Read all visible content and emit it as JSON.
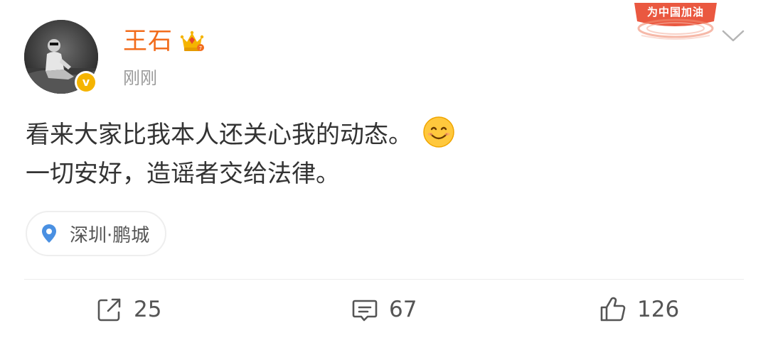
{
  "post": {
    "author": {
      "name": "王石",
      "verified_icon": "verified-badge-icon",
      "crown_badge_icon": "crown-icon"
    },
    "timestamp": "刚刚",
    "event_badge": "为中国加油",
    "content": {
      "line1": "看来大家比我本人还关心我的动态。",
      "line2": "一切安好，造谣者交给法律。"
    },
    "location": "深圳·鹏城"
  },
  "actions": {
    "repost": {
      "icon": "share-icon",
      "count": "25"
    },
    "comment": {
      "icon": "comment-icon",
      "count": "67"
    },
    "like": {
      "icon": "thumbs-up-icon",
      "count": "126"
    }
  },
  "colors": {
    "username": "#f26c1c",
    "text": "#333333",
    "muted": "#9a9a9a",
    "verified": "#f5b400",
    "location_pin": "#4a90e2",
    "badge": "#e8462b"
  }
}
